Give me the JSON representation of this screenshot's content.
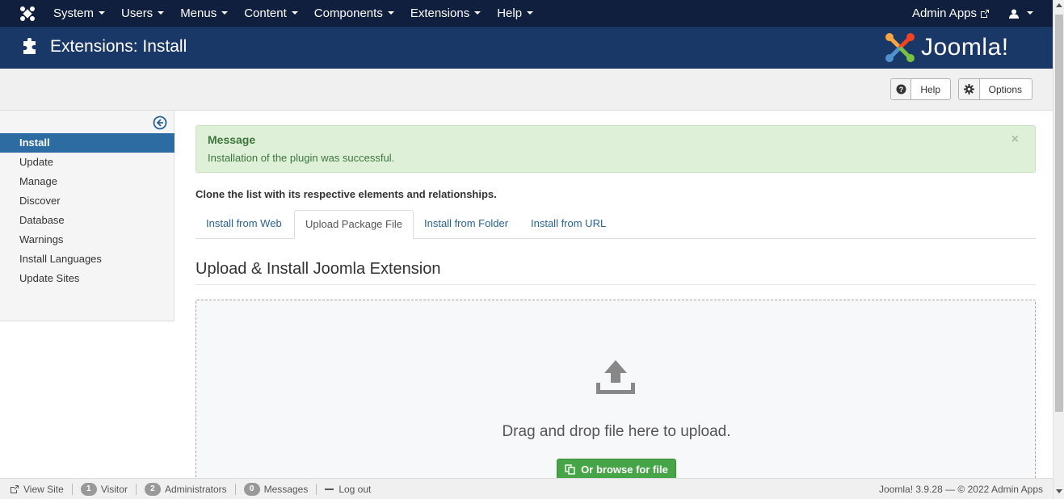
{
  "navbar": {
    "menu": [
      "System",
      "Users",
      "Menus",
      "Content",
      "Components",
      "Extensions",
      "Help"
    ],
    "admin_apps": "Admin Apps"
  },
  "header": {
    "title": "Extensions: Install",
    "logo_text": "Joomla!"
  },
  "toolbar": {
    "help_label": "Help",
    "options_label": "Options"
  },
  "sidebar": {
    "items": [
      {
        "label": "Install",
        "active": true
      },
      {
        "label": "Update"
      },
      {
        "label": "Manage"
      },
      {
        "label": "Discover"
      },
      {
        "label": "Database"
      },
      {
        "label": "Warnings"
      },
      {
        "label": "Install Languages"
      },
      {
        "label": "Update Sites"
      }
    ]
  },
  "message": {
    "title": "Message",
    "text": "Installation of the plugin was successful.",
    "close": "×"
  },
  "clone_note": "Clone the list with its respective elements and relationships.",
  "tabs": [
    {
      "label": "Install from Web"
    },
    {
      "label": "Upload Package File",
      "active": true
    },
    {
      "label": "Install from Folder"
    },
    {
      "label": "Install from URL"
    }
  ],
  "section": {
    "title": "Upload & Install Joomla Extension",
    "drop_text": "Drag and drop file here to upload.",
    "browse_label": "Or browse for file"
  },
  "statusbar": {
    "view_site": "View Site",
    "visitor_count": "1",
    "visitor_label": "Visitor",
    "admin_count": "2",
    "admin_label": "Administrators",
    "messages_count": "0",
    "messages_label": "Messages",
    "logout": "Log out",
    "version": "Joomla! 3.9.28 — © 2022 Admin Apps"
  },
  "colors": {
    "navbar": "#0f1f3d",
    "header": "#1a3867",
    "active_sidebar": "#2d6ca2",
    "success_bg": "#dff0d8",
    "success_text": "#3c763d",
    "browse_button": "#46a546"
  },
  "icons": {
    "brand": "joomla-logo-icon",
    "header": "puzzle-icon",
    "help": "question-circle-icon",
    "options": "gear-icon",
    "collapse": "arrow-left-circle-icon",
    "upload": "upload-icon",
    "browse": "copy-icon",
    "user": "user-icon",
    "external": "external-link-icon"
  }
}
